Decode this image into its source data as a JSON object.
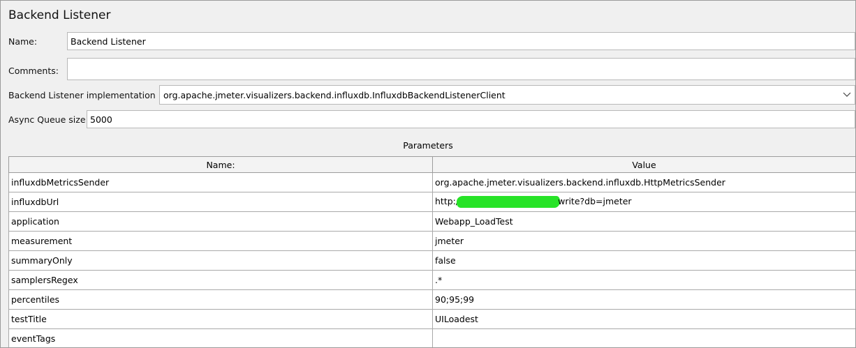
{
  "panel": {
    "title": "Backend Listener"
  },
  "form": {
    "name_label": "Name:",
    "name_value": "Backend Listener",
    "comments_label": "Comments:",
    "comments_value": "",
    "impl_label": "Backend Listener implementation",
    "impl_value": "org.apache.jmeter.visualizers.backend.influxdb.InfluxdbBackendListenerClient",
    "queue_label": "Async Queue size",
    "queue_value": "5000"
  },
  "parameters": {
    "title": "Parameters",
    "columns": [
      "Name:",
      "Value"
    ],
    "rows": [
      {
        "name": "influxdbMetricsSender",
        "value": "org.apache.jmeter.visualizers.backend.influxdb.HttpMetricsSender"
      },
      {
        "name": "influxdbUrl",
        "value_prefix": "http:/",
        "value_suffix": "write?db=jmeter"
      },
      {
        "name": "application",
        "value": "Webapp_LoadTest"
      },
      {
        "name": "measurement",
        "value": "jmeter"
      },
      {
        "name": "summaryOnly",
        "value": "false"
      },
      {
        "name": "samplersRegex",
        "value": ".*"
      },
      {
        "name": "percentiles",
        "value": "90;95;99"
      },
      {
        "name": "testTitle",
        "value": "UILoadest"
      },
      {
        "name": "eventTags",
        "value": ""
      }
    ]
  },
  "icons": {
    "dropdown": "chevron-down-icon"
  },
  "colors": {
    "redaction": "#27e327"
  }
}
